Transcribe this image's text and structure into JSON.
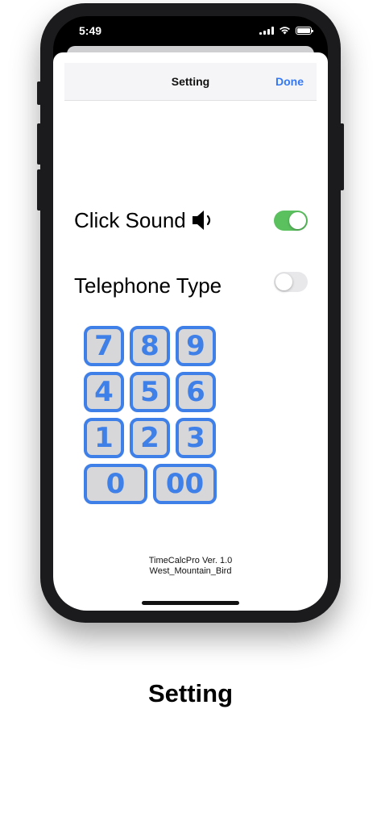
{
  "status_bar": {
    "time": "5:49"
  },
  "navbar": {
    "title": "Setting",
    "done_label": "Done"
  },
  "settings": [
    {
      "label": "Click Sound",
      "icon": "speaker-icon",
      "enabled": true
    },
    {
      "label": "Telephone Type",
      "enabled": false
    }
  ],
  "keypad": {
    "keys": [
      "7",
      "8",
      "9",
      "4",
      "5",
      "6",
      "1",
      "2",
      "3",
      "0",
      "00"
    ]
  },
  "footer": {
    "version": "TimeCalcPro Ver. 1.0",
    "author": "West_Mountain_Bird"
  },
  "caption": "Setting",
  "colors": {
    "accent": "#3478f6",
    "toggle_on": "#5bc15f",
    "key_border": "#3f7fe8",
    "key_fill": "#d7d7d9"
  }
}
